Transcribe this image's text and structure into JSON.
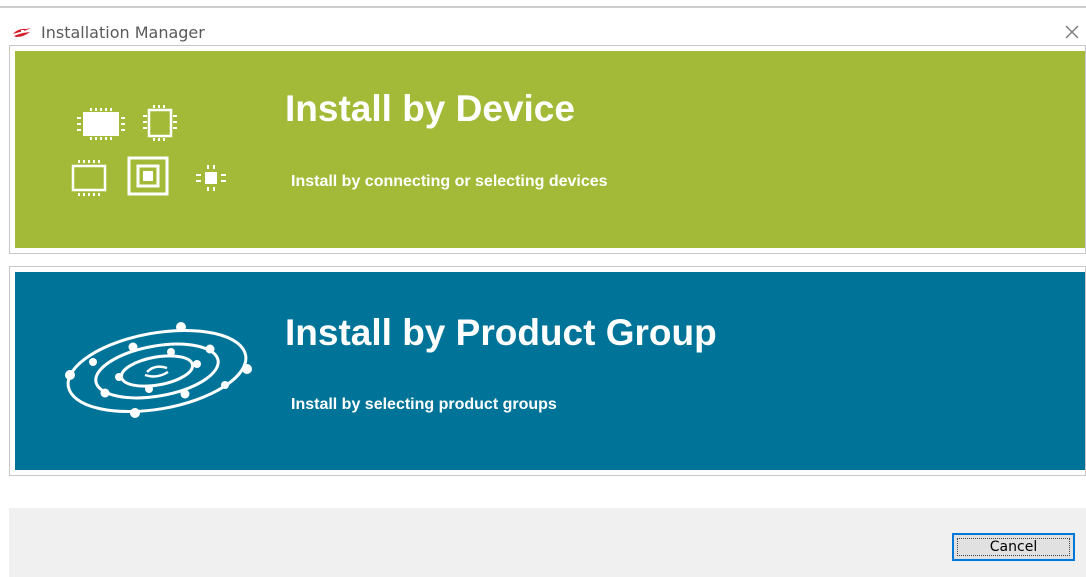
{
  "window": {
    "title": "Installation Manager",
    "app_icon": "silicon-labs-logo-icon",
    "close_icon": "close-icon"
  },
  "options": [
    {
      "title": "Install by Device",
      "subtitle": "Install by connecting or selecting devices",
      "icon": "chip-devices-icon",
      "color": "#a2ba38"
    },
    {
      "title": "Install by Product Group",
      "subtitle": "Install by selecting product groups",
      "icon": "orbit-rings-icon",
      "color": "#007498"
    }
  ],
  "footer": {
    "cancel_label": "Cancel"
  }
}
